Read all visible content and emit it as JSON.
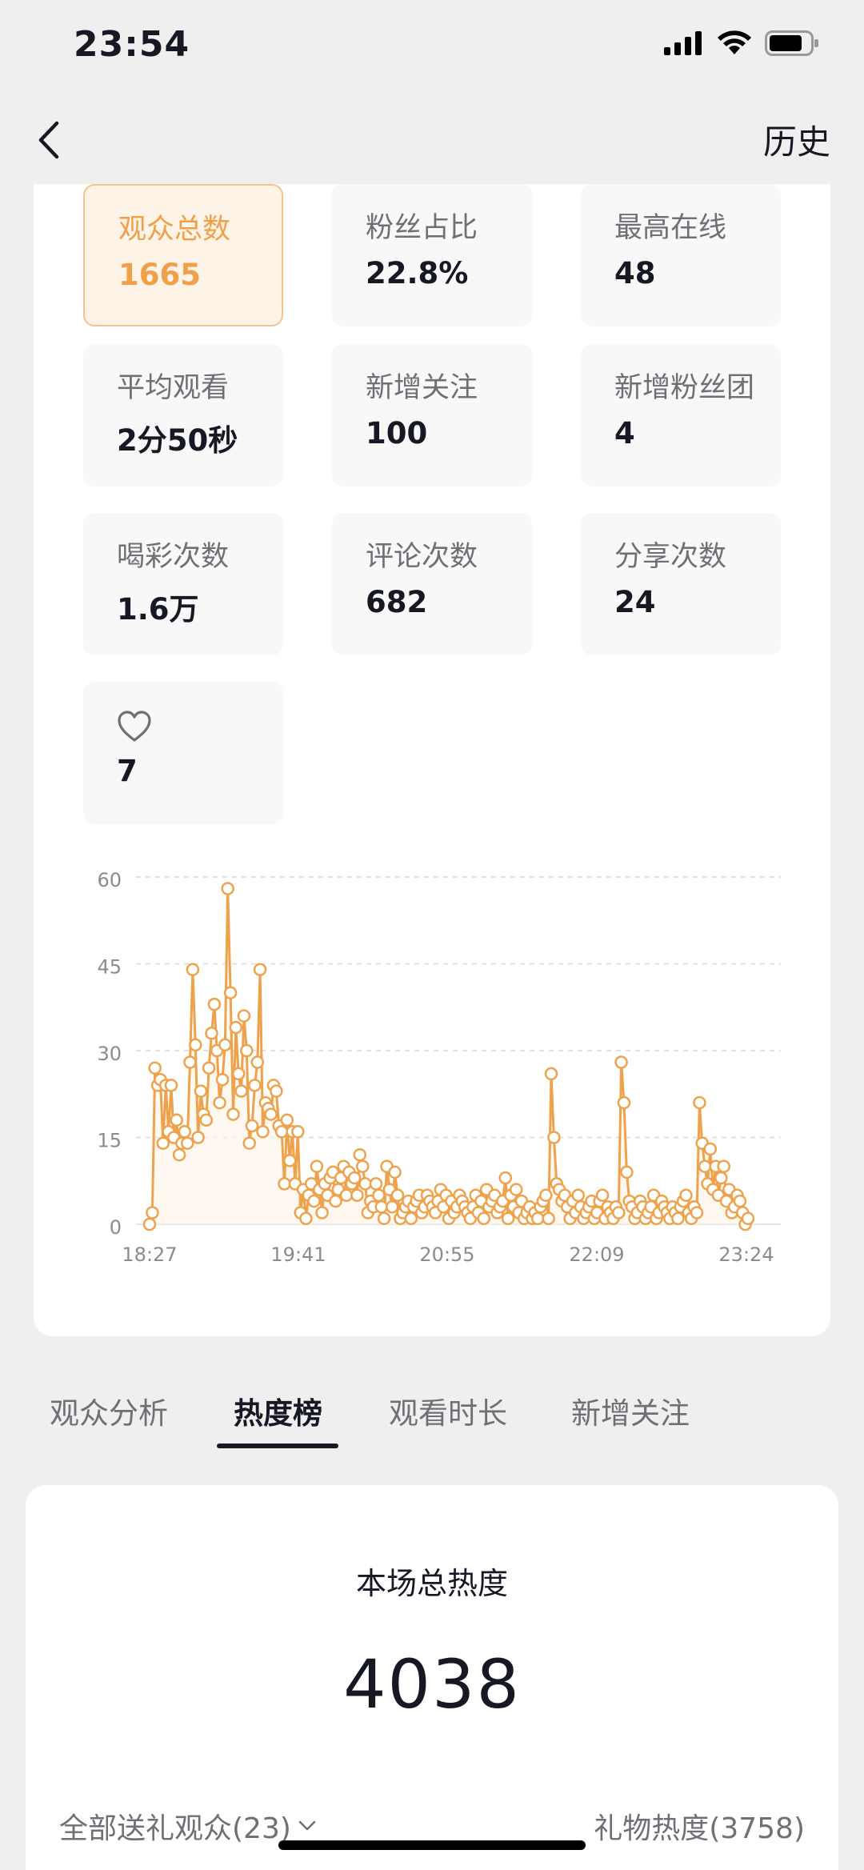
{
  "status_bar": {
    "time": "23:54"
  },
  "nav": {
    "history_label": "历史"
  },
  "stats": [
    {
      "label": "观众总数",
      "value": "1665",
      "active": true
    },
    {
      "label": "粉丝占比",
      "value": "22.8%"
    },
    {
      "label": "最高在线",
      "value": "48"
    },
    {
      "label": "平均观看",
      "value": "2分50秒"
    },
    {
      "label": "新增关注",
      "value": "100"
    },
    {
      "label": "新增粉丝团",
      "value": "4"
    },
    {
      "label": "喝彩次数",
      "value": "1.6万"
    },
    {
      "label": "评论次数",
      "value": "682"
    },
    {
      "label": "分享次数",
      "value": "24"
    },
    {
      "label": "",
      "icon": "heart-icon",
      "value": "7"
    }
  ],
  "chart_data": {
    "type": "line",
    "title": "",
    "xlabel": "",
    "ylabel": "",
    "ylim": [
      0,
      60
    ],
    "y_ticks": [
      "0",
      "15",
      "30",
      "45",
      "60"
    ],
    "x_ticks": [
      "18:27",
      "19:41",
      "20:55",
      "22:09",
      "23:24"
    ],
    "grid": true,
    "color": "#eea24c",
    "series": [
      {
        "values": [
          0,
          2,
          27,
          24,
          25,
          14,
          24,
          16,
          24,
          15,
          18,
          12,
          14,
          16,
          14,
          28,
          44,
          31,
          15,
          23,
          19,
          18,
          27,
          33,
          38,
          30,
          21,
          25,
          31,
          58,
          40,
          19,
          34,
          26,
          23,
          36,
          30,
          14,
          17,
          24,
          28,
          44,
          16,
          21,
          20,
          19,
          24,
          23,
          17,
          16,
          7,
          18,
          11,
          16,
          7,
          16,
          2,
          6,
          1,
          5,
          7,
          4,
          10,
          6,
          2,
          7,
          5,
          8,
          9,
          4,
          6,
          8,
          10,
          5,
          9,
          7,
          8,
          5,
          12,
          10,
          7,
          2,
          4,
          3,
          7,
          5,
          3,
          1,
          10,
          6,
          3,
          9,
          5,
          1,
          2,
          3,
          4,
          1,
          3,
          4,
          5,
          2,
          3,
          5,
          4,
          3,
          2,
          4,
          6,
          3,
          5,
          1,
          4,
          2,
          3,
          5,
          4,
          3,
          2,
          1,
          3,
          5,
          2,
          4,
          1,
          6,
          3,
          4,
          5,
          2,
          3,
          4,
          8,
          1,
          5,
          3,
          6,
          2,
          4,
          1,
          2,
          3,
          1,
          2,
          1,
          3,
          4,
          5,
          1,
          26,
          15,
          7,
          6,
          4,
          5,
          3,
          1,
          4,
          2,
          5,
          3,
          1,
          2,
          3,
          4,
          1,
          2,
          4,
          5,
          1,
          3,
          2,
          1,
          3,
          2,
          28,
          21,
          9,
          4,
          3,
          1,
          2,
          4,
          3,
          1,
          2,
          3,
          5,
          1,
          2,
          4,
          3,
          2,
          1,
          3,
          2,
          1,
          3,
          4,
          5,
          2,
          1,
          3,
          2,
          21,
          14,
          10,
          7,
          13,
          6,
          10,
          5,
          8,
          10,
          4,
          6,
          2,
          3,
          5,
          4,
          2,
          0,
          1
        ]
      }
    ]
  },
  "tabs": [
    "观众分析",
    "热度榜",
    "观看时长",
    "新增关注"
  ],
  "active_tab": "热度榜",
  "heat": {
    "title": "本场总热度",
    "value": "4038",
    "audience_filter": "全部送礼观众(23)",
    "gift_heat": "礼物热度(3758)"
  }
}
